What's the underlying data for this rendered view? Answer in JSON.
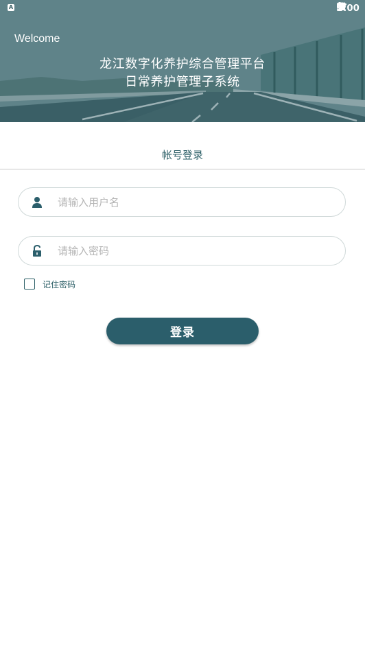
{
  "status_bar": {
    "app_badge": "A",
    "clock": "9:00",
    "icons": [
      "wifi-icon",
      "signal-icon",
      "battery-icon"
    ]
  },
  "header": {
    "welcome": "Welcome",
    "title_line1": "龙江数字化养护综合管理平台",
    "title_line2": "日常养护管理子系统"
  },
  "tab": {
    "label": "帐号登录"
  },
  "form": {
    "username": {
      "placeholder": "请输入用户名",
      "value": "",
      "icon": "user-icon"
    },
    "password": {
      "placeholder": "请输入密码",
      "value": "",
      "icon": "lock-icon"
    },
    "remember_label": "记住密码",
    "remember_checked": false,
    "login_label": "登录"
  },
  "colors": {
    "primary": "#2b5e6b",
    "text_accent": "#2b5e66",
    "placeholder": "#b5b5b5"
  }
}
